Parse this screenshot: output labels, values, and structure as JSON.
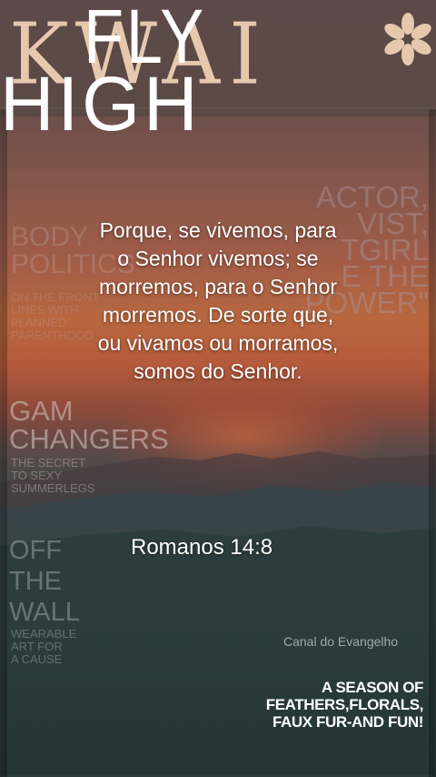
{
  "masthead": {
    "logo_text": "KWAI"
  },
  "verse": {
    "lines": [
      "Porque, se vivemos, para",
      "o Senhor vivemos; se",
      "morremos, para o Senhor",
      "morremos. De sorte que,",
      "ou vivamos ou morramos,",
      "somos do Senhor."
    ],
    "reference": "Romanos 14:8"
  },
  "watermark": "Canal do Evangelho",
  "cover_lines": {
    "actor": [
      "ACTOR,",
      "VIST,",
      "TGIRL",
      "E THE",
      "POWER\""
    ],
    "body": [
      "BODY",
      "POLITICS"
    ],
    "body_sub": [
      "ON THE FRONT",
      "LINES WITH",
      "PLANNED",
      "PARENTHOOD"
    ],
    "gam": [
      "GAM",
      "CHANGERS"
    ],
    "gam_sub": [
      "THE SECRET",
      "TO SEXY",
      "SUMMERLEGS"
    ],
    "off": [
      "OFF",
      "THE",
      "WALL"
    ],
    "off_sub": [
      "WEARABLE",
      "ART FOR",
      "A CAUSE"
    ],
    "fly": "FLY",
    "high": "HIGH",
    "fly_sub": [
      "A SEASON OF",
      "FEATHERS,FLORALS,",
      "FAUX FUR-AND FUN!"
    ]
  },
  "colors": {
    "logo": "#e6c9ad",
    "verse_text": "#ffffff",
    "sky_top": "#5a4948",
    "sunset": "#b8673f",
    "ground": "#253535"
  },
  "icons": {
    "logo_mark": "flower-icon"
  }
}
